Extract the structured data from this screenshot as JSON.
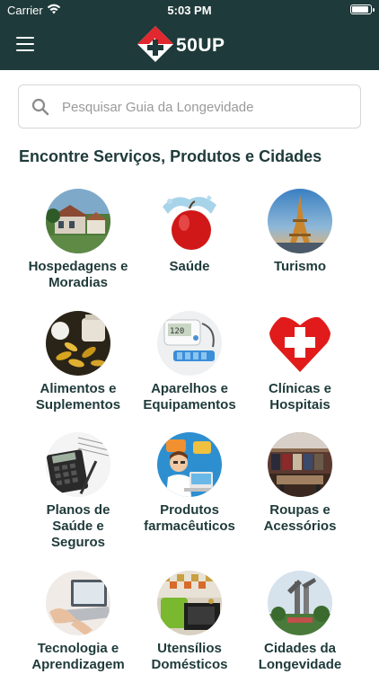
{
  "status_bar": {
    "carrier": "Carrier",
    "time": "5:03 PM",
    "battery_level": 0.9
  },
  "header": {
    "logo_text": "50UP",
    "menu_icon": "hamburger-menu-icon",
    "brand_colors": {
      "navbar": "#1f3a3a",
      "logo_red": "#e0282e"
    }
  },
  "search": {
    "placeholder": "Pesquisar Guia da Longevidade",
    "value": ""
  },
  "section_title": "Encontre Serviços, Produtos e Cidades",
  "categories": [
    {
      "label": "Hospedagens e\nMoradias",
      "icon": "house-photo"
    },
    {
      "label": "Saúde",
      "icon": "apple-splash-photo"
    },
    {
      "label": "Turismo",
      "icon": "eiffel-tower-photo"
    },
    {
      "label": "Alimentos e\nSuplementos",
      "icon": "supplements-photo"
    },
    {
      "label": "Aparelhos e\nEquipamentos",
      "icon": "blood-pressure-monitor-photo"
    },
    {
      "label": "Clínicas e\nHospitais",
      "icon": "heart-cross-icon"
    },
    {
      "label": "Planos de\nSaúde e\nSeguros",
      "icon": "calculator-photo"
    },
    {
      "label": "Produtos\nfarmacêuticos",
      "icon": "pharmacist-illustration"
    },
    {
      "label": "Roupas e\nAcessórios",
      "icon": "clothing-store-photo"
    },
    {
      "label": "Tecnologia e\nAprendizagem",
      "icon": "laptop-photo"
    },
    {
      "label": "Utensílios\nDomésticos",
      "icon": "kitchen-photo"
    },
    {
      "label": "Cidades da\nLongevidade",
      "icon": "city-tower-photo"
    }
  ]
}
